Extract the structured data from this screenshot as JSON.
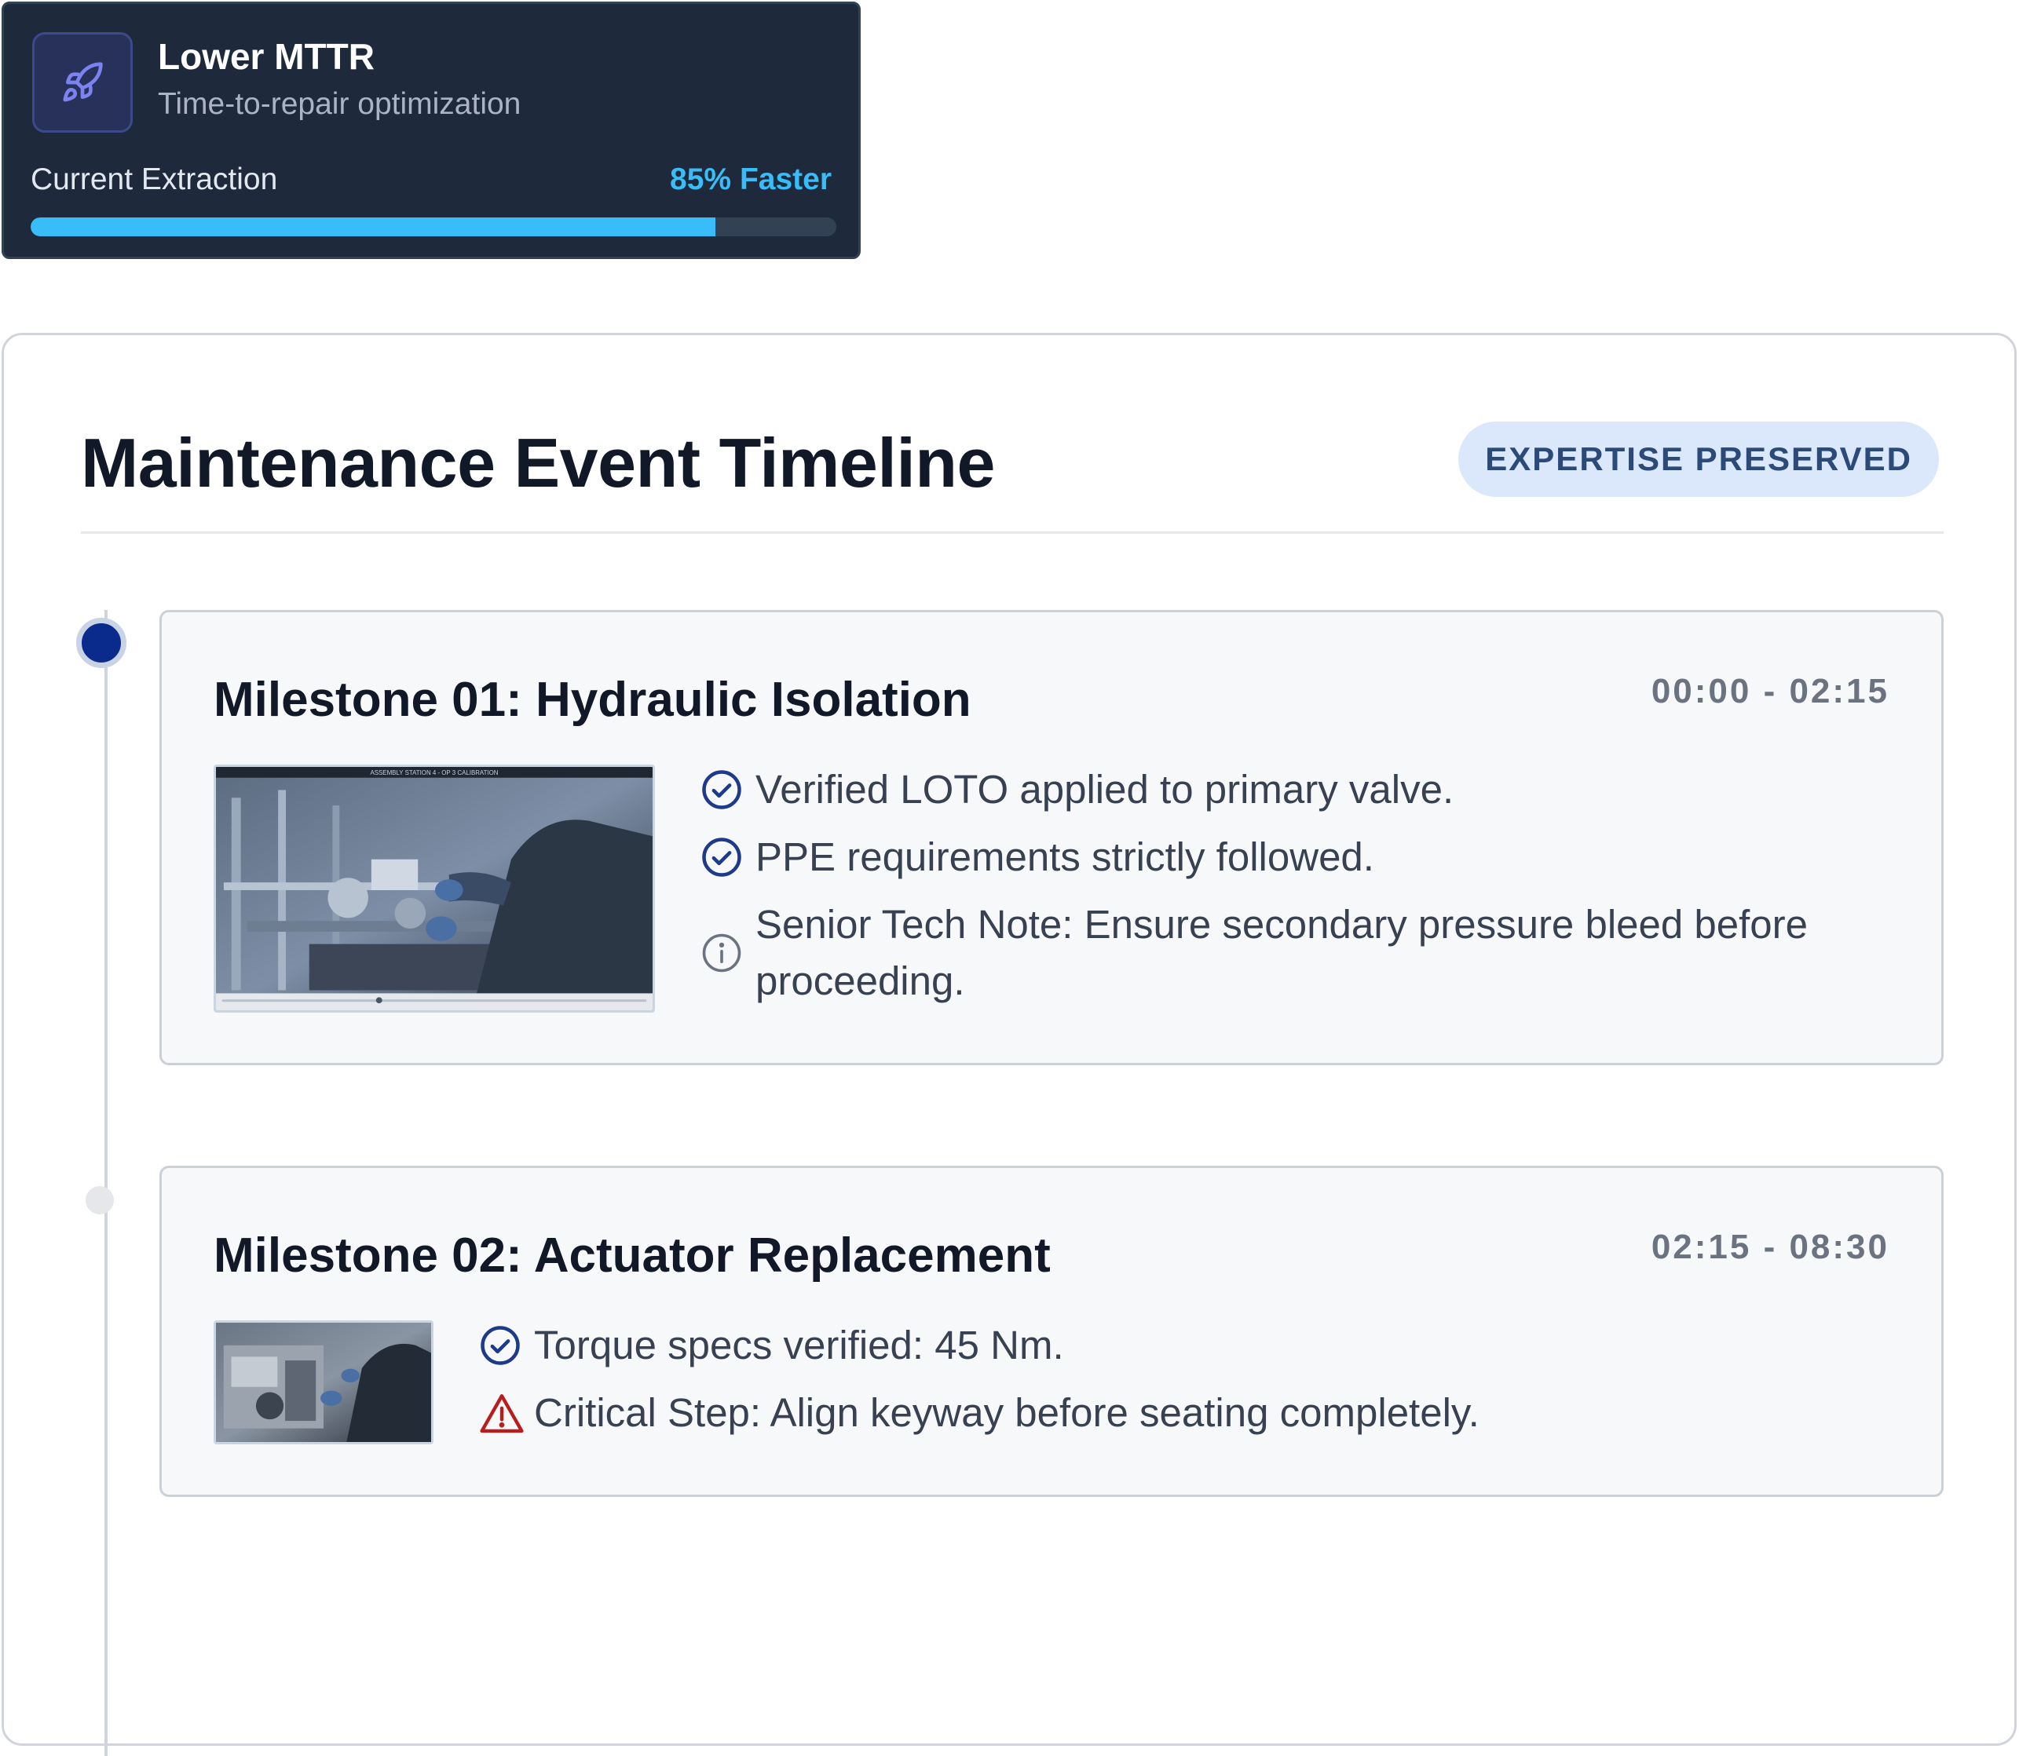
{
  "metric": {
    "icon": "rocket-icon",
    "title": "Lower MTTR",
    "subtitle": "Time-to-repair optimization",
    "label": "Current Extraction",
    "value": "85% Faster",
    "progress_fraction": 0.85,
    "accent": "#38bdf8"
  },
  "panel": {
    "title": "Maintenance Event Timeline",
    "badge": "EXPERTISE PRESERVED"
  },
  "milestones": [
    {
      "title": "Milestone 01: Hydraulic Isolation",
      "time": "00:00 - 02:15",
      "thumbnail_caption": "ASSEMBLY STATION 4 - OP 3 CALIBRATION",
      "items": [
        {
          "icon": "check-circle-icon",
          "text": "Verified LOTO applied to primary valve."
        },
        {
          "icon": "check-circle-icon",
          "text": "PPE requirements strictly followed."
        },
        {
          "icon": "info-icon",
          "text": "Senior Tech Note: Ensure secondary pressure bleed before proceeding."
        }
      ]
    },
    {
      "title": "Milestone 02: Actuator Replacement",
      "time": "02:15 - 08:30",
      "items": [
        {
          "icon": "check-circle-icon",
          "text": "Torque specs verified: 45 Nm."
        },
        {
          "icon": "warning-icon",
          "text": "Critical Step: Align keyway before seating completely."
        }
      ]
    }
  ],
  "colors": {
    "check": "#1e3a8a",
    "warning": "#b91c1c",
    "active_dot": "#0a2a8c"
  }
}
